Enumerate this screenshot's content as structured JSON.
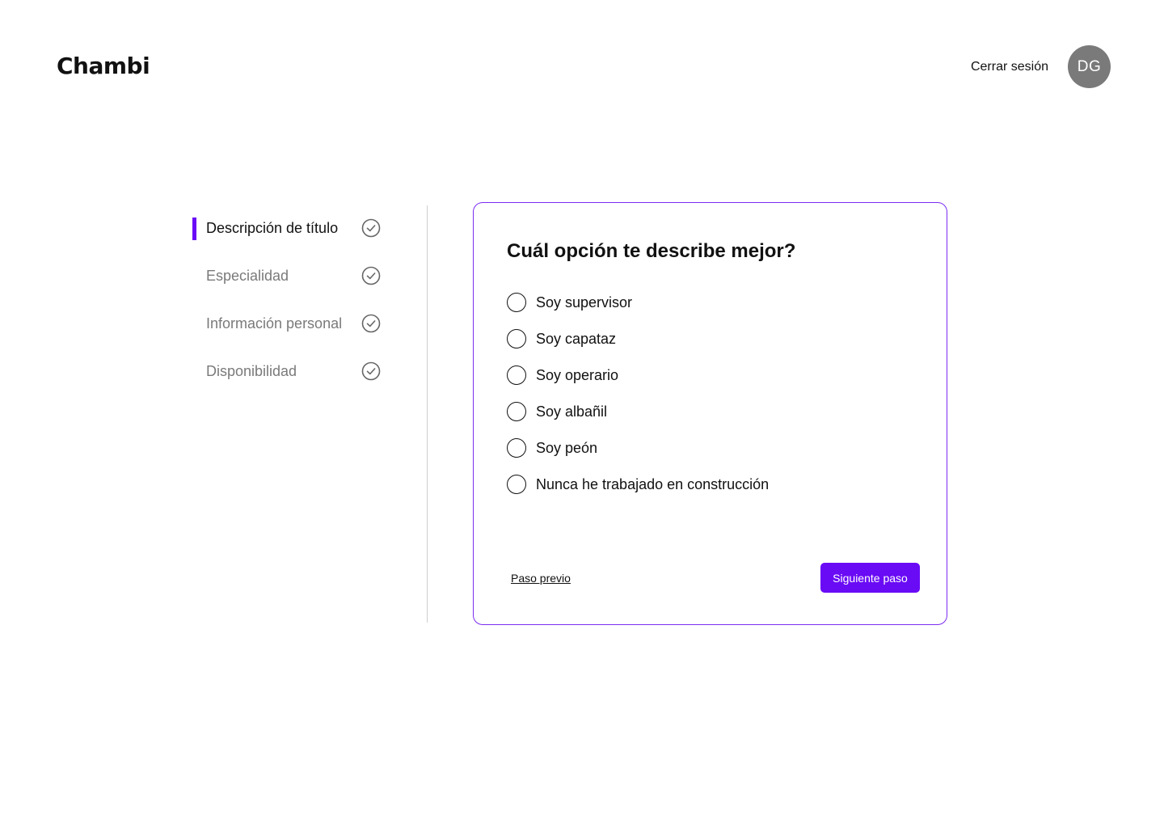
{
  "header": {
    "logo": "Chambi",
    "logout_label": "Cerrar sesión",
    "avatar_initials": "DG"
  },
  "steps": [
    {
      "label": "Descripción de título",
      "active": true,
      "icon": "check-circle-icon"
    },
    {
      "label": "Especialidad",
      "active": false,
      "icon": "check-circle-icon"
    },
    {
      "label": "Información personal",
      "active": false,
      "icon": "check-circle-icon"
    },
    {
      "label": "Disponibilidad",
      "active": false,
      "icon": "check-circle-icon"
    }
  ],
  "form": {
    "question": "Cuál opción te describe mejor?",
    "options": [
      "Soy supervisor",
      "Soy capataz",
      "Soy operario",
      "Soy albañil",
      "Soy peón",
      "Nunca he trabajado en construcción"
    ],
    "prev_label": "Paso previo",
    "next_label": "Siguiente paso"
  },
  "colors": {
    "accent": "#6a0bf5",
    "card_border": "#7b2cf0",
    "inactive_text": "#7a7a7a",
    "avatar_bg": "#7a7a7a"
  }
}
